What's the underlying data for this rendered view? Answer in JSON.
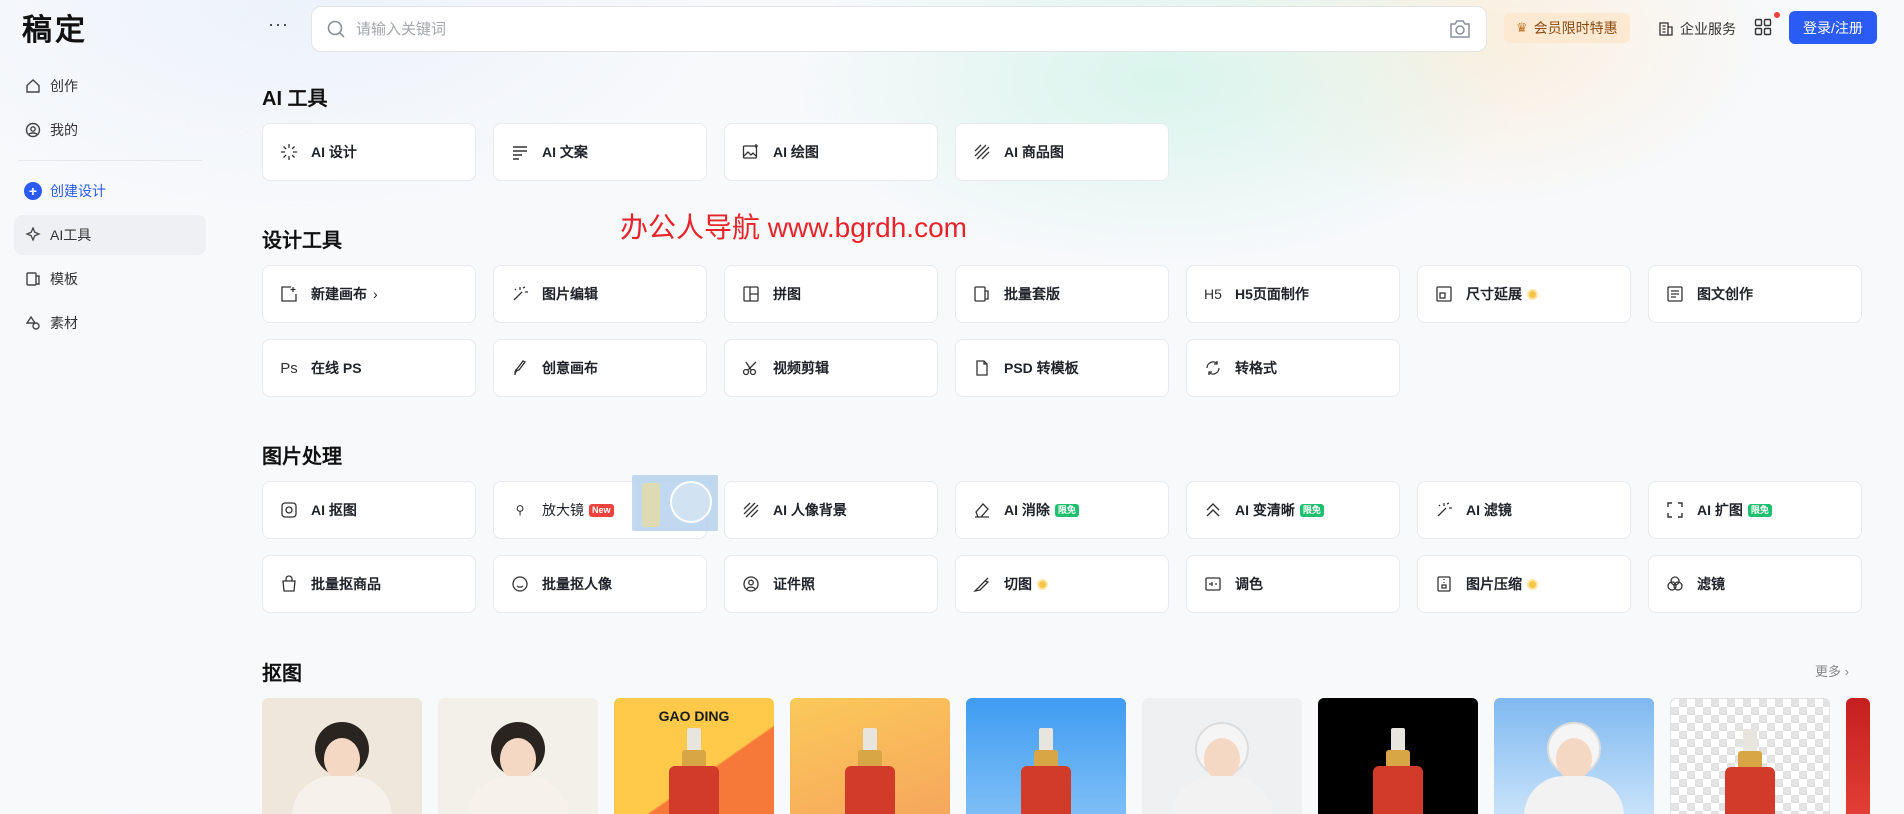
{
  "app": {
    "logo": "稿定",
    "more": "···"
  },
  "sidebar": {
    "items": [
      {
        "label": "创作",
        "icon": "home-icon"
      },
      {
        "label": "我的",
        "icon": "user-icon"
      }
    ],
    "create": {
      "label": "创建设计",
      "icon": "plus-icon"
    },
    "items2": [
      {
        "label": "AI工具",
        "icon": "sparkle-icon",
        "active": true
      },
      {
        "label": "模板",
        "icon": "template-icon"
      },
      {
        "label": "素材",
        "icon": "material-icon"
      }
    ]
  },
  "search": {
    "placeholder": "请输入关键词"
  },
  "header": {
    "vip_label": "会员限时特惠",
    "biz_label": "企业服务",
    "login_label": "登录/注册"
  },
  "watermark": "办公人导航  www.bgrdh.com",
  "sections": {
    "ai_tools": {
      "title": "AI 工具",
      "cards": [
        "AI 设计",
        "AI 文案",
        "AI 绘图",
        "AI 商品图"
      ]
    },
    "design_tools": {
      "title": "设计工具",
      "cards": [
        "新建画布",
        "图片编辑",
        "拼图",
        "批量套版",
        "H5页面制作",
        "尺寸延展",
        "图文创作",
        "在线 PS",
        "创意画布",
        "视频剪辑",
        "PSD 转模板",
        "转格式"
      ]
    },
    "image_processing": {
      "title": "图片处理",
      "cards": [
        "AI 抠图",
        "放大镜",
        "AI 人像背景",
        "AI 消除",
        "AI 变清晰",
        "AI 滤镜",
        "AI 扩图",
        "批量抠商品",
        "批量抠人像",
        "证件照",
        "切图",
        "调色",
        "图片压缩",
        "滤镜"
      ],
      "badge_new": "New",
      "badge_free": "限免"
    },
    "cutout": {
      "title": "抠图",
      "more_label": "更多",
      "thumb_text": "GAO DING"
    }
  },
  "icons": {
    "h5": "H5",
    "ps": "Ps"
  },
  "colors": {
    "primary": "#2b5bf5",
    "vip_bg": "#fde9d2",
    "watermark": "#e8242a",
    "badge_new": "#f0423d",
    "badge_free": "#1fbf6e"
  }
}
